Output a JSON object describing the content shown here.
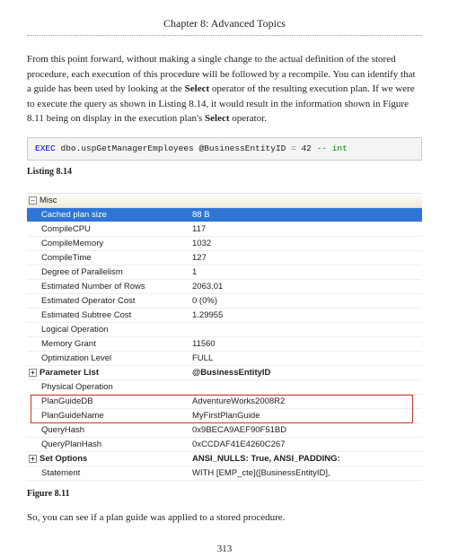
{
  "chapter": "Chapter 8: Advanced Topics",
  "para1_a": "From this point forward, without making a single change to the actual definition of the stored procedure, each execution of this procedure will be followed by a recompile. You can identify that a guide has been used by looking at the ",
  "para1_b": "Select",
  "para1_c": " operator of the resulting execution plan. If we were to execute the query as shown in Listing 8.14, it would result in the information shown in Figure 8.11 being on display in the execution plan's ",
  "para1_d": "Select",
  "para1_e": " operator.",
  "code": {
    "exec": "EXEC",
    "proc": " dbo.uspGetManagerEmployees ",
    "param": "@BusinessEntityID",
    "eq": " = ",
    "val": "42",
    "comment": " -- int"
  },
  "listing_label": "Listing 8.14",
  "grid": {
    "header1": "Misc",
    "rows": [
      {
        "k": "Cached plan size",
        "v": "88 B",
        "cls": "highlight"
      },
      {
        "k": "CompileCPU",
        "v": "117"
      },
      {
        "k": "CompileMemory",
        "v": "1032"
      },
      {
        "k": "CompileTime",
        "v": "127"
      },
      {
        "k": "Degree of Parallelism",
        "v": "1"
      },
      {
        "k": "Estimated Number of Rows",
        "v": "2063.01"
      },
      {
        "k": "Estimated Operator Cost",
        "v": "0 (0%)"
      },
      {
        "k": "Estimated Subtree Cost",
        "v": "1.29955"
      },
      {
        "k": "Logical Operation",
        "v": ""
      },
      {
        "k": "Memory Grant",
        "v": "11560"
      },
      {
        "k": "Optimization Level",
        "v": "FULL"
      }
    ],
    "paramlist_k": "Parameter List",
    "paramlist_v": "@BusinessEntityID",
    "physop": "Physical Operation",
    "red_rows": [
      {
        "k": "PlanGuideDB",
        "v": "AdventureWorks2008R2"
      },
      {
        "k": "PlanGuideName",
        "v": "MyFirstPlanGuide"
      }
    ],
    "tail_rows": [
      {
        "k": "QueryHash",
        "v": "0x9BECA9AEF90F51BD"
      },
      {
        "k": "QueryPlanHash",
        "v": "0xCCDAF41E4260C267"
      }
    ],
    "setopt_k": "Set Options",
    "setopt_v": "ANSI_NULLS: True, ANSI_PADDING:",
    "stmt_k": "Statement",
    "stmt_v": "WITH [EMP_cte]([BusinessEntityID],"
  },
  "figure_label": "Figure 8.11",
  "para2": "So, you can see if a plan guide was applied to a stored procedure.",
  "page_num": "313"
}
